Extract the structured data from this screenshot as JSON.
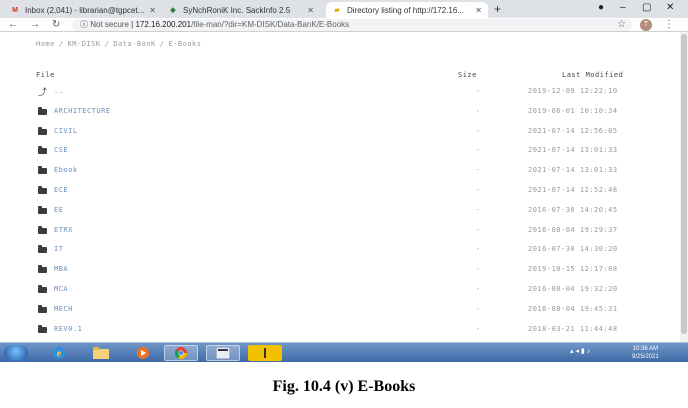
{
  "browser": {
    "tabs": [
      {
        "label": "Inbox (2,041) - librarian@tgpcet...",
        "icon": "gmail-icon",
        "active": false
      },
      {
        "label": "SyNchRoniK Inc. SackInfo 2.5",
        "icon": "app-icon",
        "active": false
      },
      {
        "label": "Directory listing of http://172.16...",
        "icon": "folder-icon",
        "active": true
      }
    ],
    "new_tab": "+",
    "not_secure": "Not secure",
    "url_host": "172.16.200.201",
    "url_path": "/file-man/?dir=KM-DISK/Data-BanK/E-Books",
    "avatar_letter": "T"
  },
  "page": {
    "breadcrumb": [
      "Home",
      "KM-DISK",
      "Data-BanK",
      "E-Books"
    ],
    "columns": {
      "file": "File",
      "size": "Size",
      "modified": "Last Modified"
    },
    "rows": [
      {
        "name": "..",
        "size": "-",
        "modified": "2019-12-09 12:22:10",
        "type": "up"
      },
      {
        "name": "ARCHITECTURE",
        "size": "-",
        "modified": "2019-06-01 10:10:34",
        "type": "folder"
      },
      {
        "name": "CIVIL",
        "size": "-",
        "modified": "2021-07-14 12:56:05",
        "type": "folder"
      },
      {
        "name": "CSE",
        "size": "-",
        "modified": "2021-07-14 13:01:33",
        "type": "folder"
      },
      {
        "name": "Ebook",
        "size": "-",
        "modified": "2021-07-14 13:01:33",
        "type": "folder"
      },
      {
        "name": "ECE",
        "size": "-",
        "modified": "2021-07-14 12:52:48",
        "type": "folder"
      },
      {
        "name": "EE",
        "size": "-",
        "modified": "2016-07-30 14:20:45",
        "type": "folder"
      },
      {
        "name": "ETRX",
        "size": "-",
        "modified": "2016-08-04 19:29:37",
        "type": "folder"
      },
      {
        "name": "IT",
        "size": "-",
        "modified": "2016-07-30 14:30:20",
        "type": "folder"
      },
      {
        "name": "MBA",
        "size": "-",
        "modified": "2019-10-15 12:17:08",
        "type": "folder"
      },
      {
        "name": "MCA",
        "size": "-",
        "modified": "2016-08-04 19:32:20",
        "type": "folder"
      },
      {
        "name": "MECH",
        "size": "-",
        "modified": "2016-08-04 19:45:31",
        "type": "folder"
      },
      {
        "name": "REV0.1",
        "size": "-",
        "modified": "2018-03-21 11:44:48",
        "type": "folder"
      }
    ]
  },
  "taskbar": {
    "clock_time": "10:36 AM",
    "clock_date": "9/25/2021"
  },
  "caption": "Fig. 10.4 (v) E-Books"
}
